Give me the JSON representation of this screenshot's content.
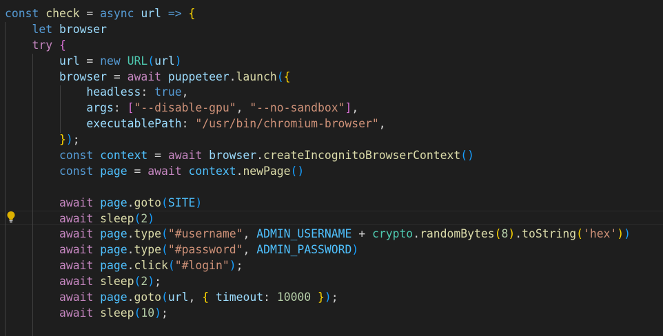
{
  "editor": {
    "colors": {
      "background": "#1e1e1e",
      "keyword": "#569cd6",
      "control": "#c586c0",
      "variable": "#9cdcfe",
      "function": "#dcdcaa",
      "string": "#ce9178",
      "number": "#b5cea8",
      "class": "#4ec9b0",
      "constant": "#4fc1ff",
      "bracket_1": "#ffd700",
      "bracket_2": "#da70d6",
      "bracket_3": "#179fff"
    },
    "gutter_icon": "lightbulb-icon",
    "lines": [
      [
        {
          "c": "kw",
          "t": "const"
        },
        {
          "c": "plain",
          "t": " "
        },
        {
          "c": "fn",
          "t": "check"
        },
        {
          "c": "plain",
          "t": " = "
        },
        {
          "c": "kw",
          "t": "async"
        },
        {
          "c": "plain",
          "t": " "
        },
        {
          "c": "var",
          "t": "url"
        },
        {
          "c": "plain",
          "t": " "
        },
        {
          "c": "kw",
          "t": "=>"
        },
        {
          "c": "plain",
          "t": " "
        },
        {
          "c": "b1",
          "t": "{"
        }
      ],
      [
        {
          "c": "plain",
          "t": "    "
        },
        {
          "c": "kw",
          "t": "let"
        },
        {
          "c": "plain",
          "t": " "
        },
        {
          "c": "var",
          "t": "browser"
        }
      ],
      [
        {
          "c": "plain",
          "t": "    "
        },
        {
          "c": "ctrl",
          "t": "try"
        },
        {
          "c": "plain",
          "t": " "
        },
        {
          "c": "b2",
          "t": "{"
        }
      ],
      [
        {
          "c": "plain",
          "t": "        "
        },
        {
          "c": "var",
          "t": "url"
        },
        {
          "c": "plain",
          "t": " = "
        },
        {
          "c": "kw",
          "t": "new"
        },
        {
          "c": "plain",
          "t": " "
        },
        {
          "c": "cls",
          "t": "URL"
        },
        {
          "c": "b3",
          "t": "("
        },
        {
          "c": "var",
          "t": "url"
        },
        {
          "c": "b3",
          "t": ")"
        }
      ],
      [
        {
          "c": "plain",
          "t": "        "
        },
        {
          "c": "var",
          "t": "browser"
        },
        {
          "c": "plain",
          "t": " = "
        },
        {
          "c": "ctrl",
          "t": "await"
        },
        {
          "c": "plain",
          "t": " "
        },
        {
          "c": "var",
          "t": "puppeteer"
        },
        {
          "c": "plain",
          "t": "."
        },
        {
          "c": "fn",
          "t": "launch"
        },
        {
          "c": "b3",
          "t": "("
        },
        {
          "c": "b1",
          "t": "{"
        }
      ],
      [
        {
          "c": "plain",
          "t": "            "
        },
        {
          "c": "var",
          "t": "headless"
        },
        {
          "c": "plain",
          "t": ": "
        },
        {
          "c": "kw",
          "t": "true"
        },
        {
          "c": "plain",
          "t": ","
        }
      ],
      [
        {
          "c": "plain",
          "t": "            "
        },
        {
          "c": "var",
          "t": "args"
        },
        {
          "c": "plain",
          "t": ": "
        },
        {
          "c": "b2",
          "t": "["
        },
        {
          "c": "str",
          "t": "\"--disable-gpu\""
        },
        {
          "c": "plain",
          "t": ", "
        },
        {
          "c": "str",
          "t": "\"--no-sandbox\""
        },
        {
          "c": "b2",
          "t": "]"
        },
        {
          "c": "plain",
          "t": ","
        }
      ],
      [
        {
          "c": "plain",
          "t": "            "
        },
        {
          "c": "var",
          "t": "executablePath"
        },
        {
          "c": "plain",
          "t": ": "
        },
        {
          "c": "str",
          "t": "\"/usr/bin/chromium-browser\""
        },
        {
          "c": "plain",
          "t": ","
        }
      ],
      [
        {
          "c": "plain",
          "t": "        "
        },
        {
          "c": "b1",
          "t": "}"
        },
        {
          "c": "b3",
          "t": ")"
        },
        {
          "c": "plain",
          "t": ";"
        }
      ],
      [
        {
          "c": "plain",
          "t": "        "
        },
        {
          "c": "kw",
          "t": "const"
        },
        {
          "c": "plain",
          "t": " "
        },
        {
          "c": "const",
          "t": "context"
        },
        {
          "c": "plain",
          "t": " = "
        },
        {
          "c": "ctrl",
          "t": "await"
        },
        {
          "c": "plain",
          "t": " "
        },
        {
          "c": "var",
          "t": "browser"
        },
        {
          "c": "plain",
          "t": "."
        },
        {
          "c": "fn",
          "t": "createIncognitoBrowserContext"
        },
        {
          "c": "b3",
          "t": "()"
        }
      ],
      [
        {
          "c": "plain",
          "t": "        "
        },
        {
          "c": "kw",
          "t": "const"
        },
        {
          "c": "plain",
          "t": " "
        },
        {
          "c": "const",
          "t": "page"
        },
        {
          "c": "plain",
          "t": " = "
        },
        {
          "c": "ctrl",
          "t": "await"
        },
        {
          "c": "plain",
          "t": " "
        },
        {
          "c": "const",
          "t": "context"
        },
        {
          "c": "plain",
          "t": "."
        },
        {
          "c": "fn",
          "t": "newPage"
        },
        {
          "c": "b3",
          "t": "()"
        }
      ],
      [],
      [
        {
          "c": "plain",
          "t": "        "
        },
        {
          "c": "ctrl",
          "t": "await"
        },
        {
          "c": "plain",
          "t": " "
        },
        {
          "c": "const",
          "t": "page"
        },
        {
          "c": "plain",
          "t": "."
        },
        {
          "c": "fn",
          "t": "goto"
        },
        {
          "c": "b3",
          "t": "("
        },
        {
          "c": "const",
          "t": "SITE"
        },
        {
          "c": "b3",
          "t": ")"
        }
      ],
      [
        {
          "c": "plain",
          "t": "        "
        },
        {
          "c": "ctrl",
          "t": "await"
        },
        {
          "c": "plain",
          "t": " "
        },
        {
          "c": "fn",
          "t": "sleep"
        },
        {
          "c": "b3",
          "t": "("
        },
        {
          "c": "num",
          "t": "2"
        },
        {
          "c": "b3",
          "t": ")"
        }
      ],
      [
        {
          "c": "plain",
          "t": "        "
        },
        {
          "c": "ctrl",
          "t": "await"
        },
        {
          "c": "plain",
          "t": " "
        },
        {
          "c": "const",
          "t": "page"
        },
        {
          "c": "plain",
          "t": "."
        },
        {
          "c": "fn",
          "t": "type"
        },
        {
          "c": "b3",
          "t": "("
        },
        {
          "c": "str",
          "t": "\"#username\""
        },
        {
          "c": "plain",
          "t": ", "
        },
        {
          "c": "const",
          "t": "ADMIN_USERNAME"
        },
        {
          "c": "plain",
          "t": " + "
        },
        {
          "c": "cls",
          "t": "crypto"
        },
        {
          "c": "plain",
          "t": "."
        },
        {
          "c": "fn",
          "t": "randomBytes"
        },
        {
          "c": "b1",
          "t": "("
        },
        {
          "c": "num",
          "t": "8"
        },
        {
          "c": "b1",
          "t": ")"
        },
        {
          "c": "plain",
          "t": "."
        },
        {
          "c": "fn",
          "t": "toString"
        },
        {
          "c": "b1",
          "t": "("
        },
        {
          "c": "str",
          "t": "'hex'"
        },
        {
          "c": "b1",
          "t": ")"
        },
        {
          "c": "b3",
          "t": ")"
        }
      ],
      [
        {
          "c": "plain",
          "t": "        "
        },
        {
          "c": "ctrl",
          "t": "await"
        },
        {
          "c": "plain",
          "t": " "
        },
        {
          "c": "const",
          "t": "page"
        },
        {
          "c": "plain",
          "t": "."
        },
        {
          "c": "fn",
          "t": "type"
        },
        {
          "c": "b3",
          "t": "("
        },
        {
          "c": "str",
          "t": "\"#password\""
        },
        {
          "c": "plain",
          "t": ", "
        },
        {
          "c": "const",
          "t": "ADMIN_PASSWORD"
        },
        {
          "c": "b3",
          "t": ")"
        }
      ],
      [
        {
          "c": "plain",
          "t": "        "
        },
        {
          "c": "ctrl",
          "t": "await"
        },
        {
          "c": "plain",
          "t": " "
        },
        {
          "c": "const",
          "t": "page"
        },
        {
          "c": "plain",
          "t": "."
        },
        {
          "c": "fn",
          "t": "click"
        },
        {
          "c": "b3",
          "t": "("
        },
        {
          "c": "str",
          "t": "\"#login\""
        },
        {
          "c": "b3",
          "t": ")"
        },
        {
          "c": "plain",
          "t": ";"
        }
      ],
      [
        {
          "c": "plain",
          "t": "        "
        },
        {
          "c": "ctrl",
          "t": "await"
        },
        {
          "c": "plain",
          "t": " "
        },
        {
          "c": "fn",
          "t": "sleep"
        },
        {
          "c": "b3",
          "t": "("
        },
        {
          "c": "num",
          "t": "2"
        },
        {
          "c": "b3",
          "t": ")"
        },
        {
          "c": "plain",
          "t": ";"
        }
      ],
      [
        {
          "c": "plain",
          "t": "        "
        },
        {
          "c": "ctrl",
          "t": "await"
        },
        {
          "c": "plain",
          "t": " "
        },
        {
          "c": "const",
          "t": "page"
        },
        {
          "c": "plain",
          "t": "."
        },
        {
          "c": "fn",
          "t": "goto"
        },
        {
          "c": "b3",
          "t": "("
        },
        {
          "c": "var",
          "t": "url"
        },
        {
          "c": "plain",
          "t": ", "
        },
        {
          "c": "b1",
          "t": "{"
        },
        {
          "c": "plain",
          "t": " "
        },
        {
          "c": "var",
          "t": "timeout"
        },
        {
          "c": "plain",
          "t": ": "
        },
        {
          "c": "num",
          "t": "10000"
        },
        {
          "c": "plain",
          "t": " "
        },
        {
          "c": "b1",
          "t": "}"
        },
        {
          "c": "b3",
          "t": ")"
        },
        {
          "c": "plain",
          "t": ";"
        }
      ],
      [
        {
          "c": "plain",
          "t": "        "
        },
        {
          "c": "ctrl",
          "t": "await"
        },
        {
          "c": "plain",
          "t": " "
        },
        {
          "c": "fn",
          "t": "sleep"
        },
        {
          "c": "b3",
          "t": "("
        },
        {
          "c": "num",
          "t": "10"
        },
        {
          "c": "b3",
          "t": ")"
        },
        {
          "c": "plain",
          "t": ";"
        }
      ]
    ]
  }
}
